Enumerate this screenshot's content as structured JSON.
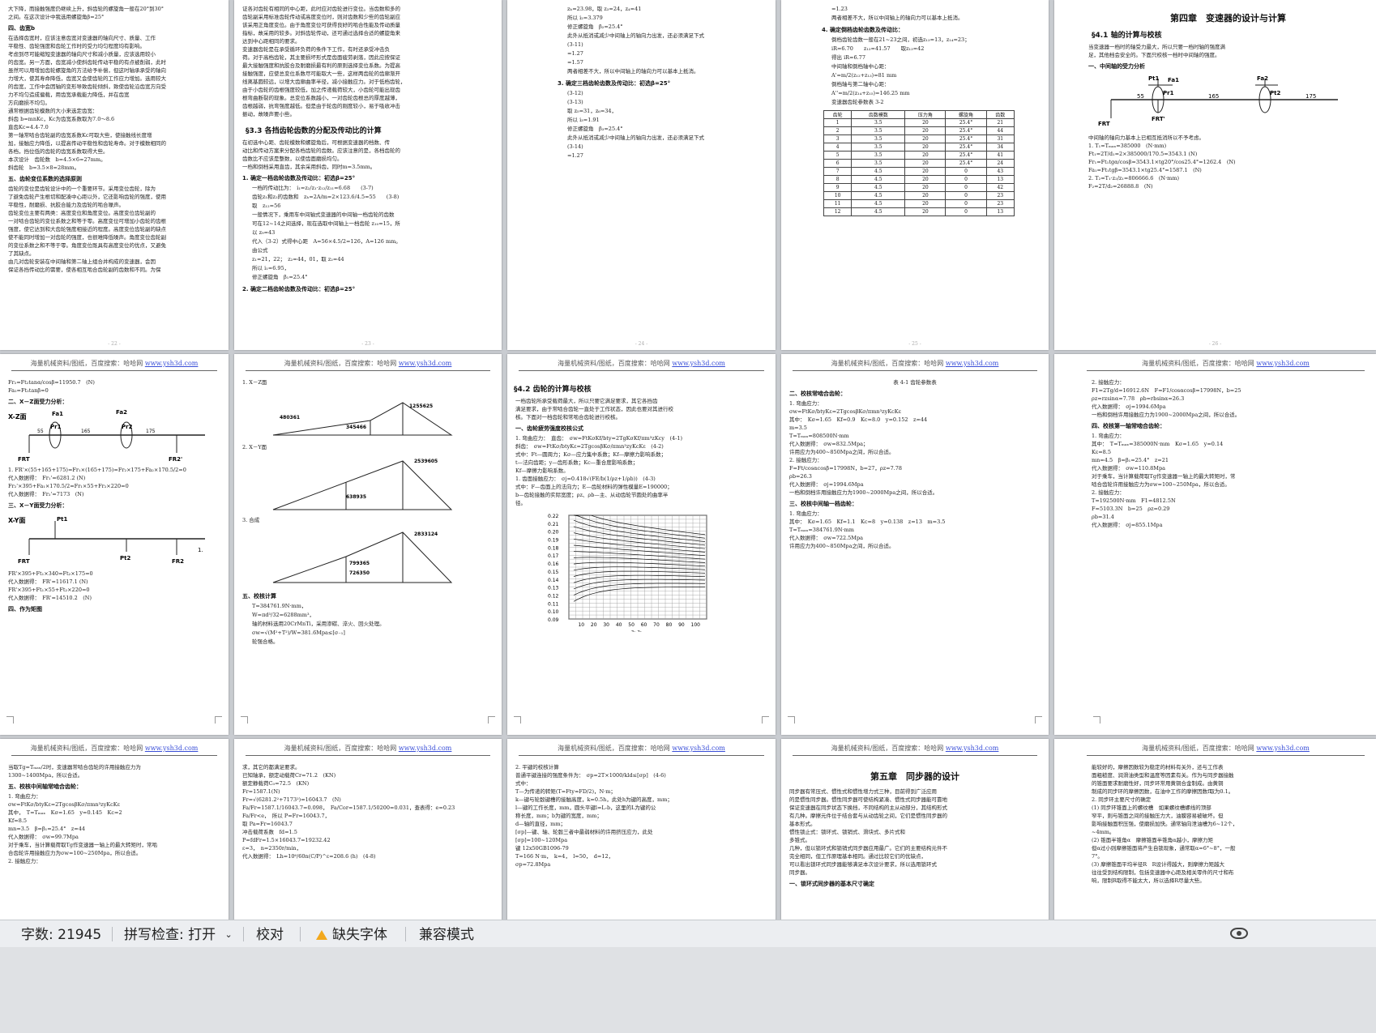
{
  "status_bar": {
    "word_count": "字数: 21945",
    "spell_check": "拼写检查: 打开",
    "proofread": "校对",
    "missing_fonts": "缺失字体",
    "compat_mode": "兼容模式"
  },
  "watermark": "海量机械资料/图纸，百度搜索：哈哈网",
  "watermark_url": "www.ysh3d.com",
  "pages": {
    "p1": {
      "lines": [
        "大下降，而接触强度仍继续上升，斜齿轮的螺旋角一般在20°到30°",
        "之间。在这次设计中我选用螺旋角β=25°",
        "四、齿宽b",
        "在选择齿宽时，应该注意齿宽对变速器的轴向尺寸、质量、工作",
        "平稳性、齿轮强度和齿轮工作时的受力均匀程度均有影响。",
        "考虑到尽可能缩短变速器的轴向尺寸和减小质量，应该选用较小",
        "的齿宽。另一方面，齿宽减小使斜齿轮传动平稳的有点被削弱，此时",
        "虽然可以用增加齿轮螺旋角的方法给予补偿，但这时轴承承受的轴向",
        "力增大，使其寿命降低，齿宽又会使齿轮的工作应力增加。选用较大",
        "的齿宽，工作中会因轴的变形导致齿轮倾斜，致使齿轮沿齿宽方向受",
        "力不均匀造成偏载，用齿宽承载能力降低，并在齿宽",
        "方向磨损不均匀。",
        "通常根据齿轮模数的大小来选定齿宽：",
        "斜齿 b=mnKc，Kc为齿宽系数取为7.0～8.6",
        "直齿Kc=4.4-7.0",
        "第一轴常啮合齿轮副的齿宽系数Kc可取大些，使接触线长度增",
        "加，接触应力降低，以提高传动平稳性和齿轮寿命。对于模数相同的",
        "各档，挡位低的齿轮的齿宽系数取得大些。",
        "本次设计　齿轮数　b=4.5×6=27mm。",
        "斜齿轮　b=3.5×8=28mm。",
        "五、齿轮变位系数的选择原则",
        "齿轮的变位是齿轮设计中的一个重要环节。采用变位齿轮，除为",
        "了避免齿轮产生根切和配凑中心距以外，它还影响齿轮的强度，使用",
        "平稳性，耐磨损、抗胶合能力及齿轮的啮合噪声。",
        "齿轮变位主要有两类：高度变位和角度变位。高度变位齿轮副的",
        "一对啮合齿轮的变位系数之和等于零。高度变位可增加小齿轮的齿根",
        "强度，使它达到和大齿轮强度相接近的程度。高度变位齿轮副的缺点",
        "使不能同时增加一对齿轮的强度，也很难降低噪声。角度变位齿轮副",
        "的变位系数之和不等于零。角度变位既具有高度变位的优点，又避免",
        "了其缺点。",
        "由几对齿轮安装在中间轴和第二轴上组合并构成的变速器，会因",
        "保证各挡传动比的需要，使各相互啮合齿轮副的齿数和不同。为保"
      ]
    },
    "p2": {
      "top_lines": [
        "证各对齿轮有相同的中心距，此时应对齿轮进行变位。当齿数和多的",
        "齿轮副采用标准齿轮传动或高度变位时，则对齿数和少些的齿轮副应",
        "该采用正角度变位。由于角度变位可获得良好的啮合性能及传动质量",
        "指标，故采用的较多。对斜齿轮传动，还可通过选择合适的螺旋角来",
        "达到中心距相同的要求。",
        "变速器齿轮是在承受循环负荷的条件下工作，有时还承受冲击负",
        "荷。对于高档齿轮，其主要损坏形式是齿面疲劳剥落，因此应按保证",
        "最大接触强度和抗胶合及耐磨损最有利的原则选择变位系数。为提高",
        "接触强度，应使总变位系数尽可能取大一些，这样两齿轮的齿廓渐开",
        "线离基圆较远，以增大齿廓曲率半径，减小接触应力。对于低档齿轮，",
        "由于小齿轮的齿根强度较低，加之传递载荷较大，小齿轮可能出现齿",
        "根弯曲断裂的现象。总变位系数越小，一对齿轮齿根总的厚度越薄，",
        "齿根越弱，抗弯强度越低。但是由于轮齿的刚度较小，易于吸收冲击",
        "振动，故噪声要小些。"
      ],
      "section": "§3.3 各挡齿轮齿数的分配及传动比的计算",
      "body_lines": [
        "在初选中心距、齿轮模数和螺旋角后，可根据变速器的档数、传",
        "动比和传动方案来分配各档齿轮的齿数。应该注意的是，各档齿轮的",
        "齿数比不应该是整数，以使齿面磨损均匀。",
        "一档和倒档采用直齿，其余采用斜齿，同时m=3.5mm。"
      ],
      "h1": "1. 确定一档齿轮齿数及传动比：初选β=25°",
      "items": [
        "一档的传动比为：　i₁=z₂/z₁·z₁₂/z₁₁=6.68　　(3-7)",
        "齿轮z₁和z₂的齿数和　zₕ=2A/m=2×123.6/4.5=55　　(3-8)",
        "取　z₁₂=56",
        "一般情况下，乘用车中间轴式变速器的中间轴一档齿轮的齿数",
        "可在12~14之间选择，现在选取中间轴上一档齿轮 z₁₀=15，所",
        "以 z₉=43",
        "代入（3-2）式得中心距　A=56×4.5/2=126，A=126 mm。",
        "由公式",
        "z₁=21，22；　z₂=44，01，取 z₂=44",
        "所以 i₁=6.95，",
        "修正螺旋角　β₁=25.4°"
      ],
      "h2": "2. 确定二档齿轮齿数及传动比：初选β=25°"
    },
    "p3": {
      "lines": [
        "zₕ=23.98，取 z₃=24，z₄=41",
        "所以 i₂=3.379",
        "修正螺旋角　β₂=25.4°",
        "此外从抵消或减少中间轴上的轴向力出发，还必须满足下式",
        "(3-11)",
        "=1.27",
        "=1.57",
        "两者相差不大，所以中间轴上的轴向力可以基本上抵消。",
        "3. 确定三档齿轮齿数及传动比：初选β=25°",
        "(3-12)",
        "(3-13)",
        "取 z₅=31，z₆=34，",
        "所以 i₃=1.91",
        "修正螺旋角　β₃=25.4°",
        "此外从抵消或减少中间轴上的轴向力出发，还必须满足下式",
        "(3-14)",
        "=1.27"
      ]
    },
    "p4": {
      "lines": [
        "=1.23",
        "两者相差不大，所以中间轴上的轴向力可以基本上抵消。",
        "4. 确定倒档齿轮齿数及传动比：",
        "倒档齿轮齿数一般在21~23之间，初选z₁₃=13，z₁₄=23；",
        "iR=6.70　　z₁₃=41.57　　取z₁₃=42",
        "得出 iR=6.77",
        "中间轴和倒档轴中心距：",
        "A'=m/2(z₁₂+z₁₃)=81 mm",
        "倒档轴与第二轴中心距：",
        "A''=m/2(z₁₄+z₁₅)=146.25 mm",
        "变速器齿轮参数表 3-2"
      ],
      "table_headers": [
        "齿轮",
        "齿数模数",
        "压力角",
        "螺旋角",
        "齿数"
      ],
      "table_rows": [
        [
          "1",
          "3.5",
          "20",
          "25.4°",
          "21"
        ],
        [
          "2",
          "3.5",
          "20",
          "25.4°",
          "44"
        ],
        [
          "3",
          "3.5",
          "20",
          "25.4°",
          "31"
        ],
        [
          "4",
          "3.5",
          "20",
          "25.4°",
          "34"
        ],
        [
          "5",
          "3.5",
          "20",
          "25.4°",
          "41"
        ],
        [
          "6",
          "3.5",
          "20",
          "25.4°",
          "24"
        ],
        [
          "7",
          "4.5",
          "20",
          "0",
          "43"
        ],
        [
          "8",
          "4.5",
          "20",
          "0",
          "13"
        ],
        [
          "9",
          "4.5",
          "20",
          "0",
          "42"
        ],
        [
          "10",
          "4.5",
          "20",
          "0",
          "23"
        ],
        [
          "11",
          "4.5",
          "20",
          "0",
          "23"
        ],
        [
          "12",
          "4.5",
          "20",
          "0",
          "13"
        ]
      ]
    },
    "p5": {
      "chapter": "第四章　变速器的设计与计算",
      "section": "§4.1 轴的计算与校核",
      "lines": [
        "当变速器一档时的轴受力最大，所以只要一档时轴的强度满",
        "足，其他档会安全的。下面只校核一档时中间轴的强度。",
        "一、中间轴的受力分析",
        "中间轴的轴向力基本上已相互抵消所以不予考虑。",
        "1. T₁=Tₘₐₓ=385000　(N·mm)",
        "Ft₁=2T/d₁=2×385000/170.5=3543.1 (N)",
        "Fr₁=Ft₁tgα/cosβ=3543.1×tg20°/cos25.4°=1262.4　(N)",
        "Fa₁=Ft₁tgβ=3543.1×tg25.4°=1587.1　(N)",
        "2. T₂=T₁·z₂/z₁=806666.6　(N·mm)",
        "F₂=2T/d₂=26888.8　(N)"
      ],
      "diagram_labels": [
        "Pt1",
        "Fa1",
        "Pr1",
        "55",
        "165",
        "Fa2",
        "Pt2",
        "175",
        "FRT",
        "FRT'"
      ]
    },
    "p6": {
      "lines": [
        "Fr₂=Ft₂tanα/cosβ=11950.7　(N)",
        "Fa₂=Ft₂tanβ=0",
        "二、X－Z面受力分析：",
        "1. FR'×(55+165+175)=Fr₁×(165+175)=Fr₂×175+Fa₂×170.5/2=0",
        "代入数据得：　Fr₁'=6281.2 (N)",
        "Fr₂'×395+Fa₁×170.5/2=Fr₁×55+Fr₂×220=0",
        "代入数据得：　Fr₂'=7173　(N)",
        "三、X－Y面受力分析：",
        "FR'×395+Ft₁×340=Ft₂×175=0",
        "代入数据得：　FR'=11617.1 (N)",
        "FR'×395+Ft₁×55+Ft₂×220=0",
        "代入数据得：　FR'=14510.2　(N)",
        "四、作为矩图"
      ],
      "diagram_labels": [
        "X-Z面",
        "Fa1",
        "Fa2",
        "Pr1",
        "Pr2",
        "55",
        "165",
        "175",
        "FRT",
        "FR2'",
        "X-Y面",
        "Pt1",
        "Pt2",
        "FRT",
        "FR2"
      ],
      "page_num": "1."
    },
    "p7": {
      "lines": [
        "1. X－Z面",
        "2. X－Y面",
        "3. 合成",
        "五、校核计算",
        "T=384761.9N·mm，",
        "W=πd³/32=6288mm³，",
        "轴的材料选用20CrMnTi，采用渗碳、淬火、回火处理。",
        "σw=√(M²+T²)/W=381.6Mpa≤[σ₋₁]",
        "轮强合格。"
      ],
      "moment_values": [
        "480361",
        "345466",
        "1255625",
        "2539605",
        "638935",
        "2833124",
        "799365",
        "726350"
      ]
    },
    "p8": {
      "section": "§4.2 齿轮的计算与校核",
      "lines": [
        "一档齿轮所承受载荷最大，所以只要它满足要求，其它各挡齿",
        "满足要求，由于常啮合齿轮一直处于工作状态，因此也要对其进行校",
        "核。下面对一档齿轮和常啮合齿轮进行校核。",
        "一、齿轮疲劳强度校核公式",
        "1. 弯曲应力：　直齿：　σw=FtKσKf/bty=2TgKσKf/πm³zKcy　(4-1)",
        "斜齿：　σw=FtKσ/btyKε=2TgcosβKσ/πmn³zyKcKε　(4-2)",
        "式中：Ft—圆周力；Kσ—应力集中系数；Kf—摩擦力影响系数；",
        "t—法向齿距；y—齿形系数；Kc—重合度影响系数；",
        "Kf—摩擦力影响系数。",
        "1. 齿面接触应力：　σj=0.418√(FE/b(1/ρz+1/ρb))　(4-3)",
        "式中：F—齿面上的法向力；E—齿轮材料的弹性模量E=190000；",
        "b—齿轮接触的实际宽度；ρz、ρb—主、从动齿轮节圆处的曲率半",
        "径。"
      ],
      "chart_x_ticks": [
        "10",
        "20",
        "30",
        "40",
        "50",
        "60",
        "70",
        "80",
        "90",
        "100"
      ],
      "chart_y_ticks": [
        "0.22",
        "0.21",
        "0.20",
        "0.19",
        "0.18",
        "0.17",
        "0.16",
        "0.15",
        "0.14",
        "0.13",
        "0.12",
        "0.11",
        "0.10",
        "0.09"
      ],
      "chart_xlabel": "z₁ z₂"
    },
    "p9": {
      "header": "表 4-1 齿轮参数表",
      "lines": [
        "二、校核常啮合齿轮：",
        "1. 弯曲应力：",
        "σw=FtKσ/btyKε=2TgcosβKσ/πmn³zyKcKε",
        "其中：　Kσ=1.65　Kf=0.9　Kc=8.0　y=0.152　z=44",
        "m=3.5",
        "T=Tₘₐₓ=808500N·mm",
        "代入数据得：　σw=832.5Mpa；",
        "许用应力为400~850Mpa之间，所以合适。",
        "2. 接触应力：",
        "F=Ft/cosαcosβ=17998N，b=27，ρz=7.78",
        "ρb=26.3",
        "代入数据得：　σj=1994.6Mpa",
        "一档和倒档许用接触应力为1900~2000Mpa之间，所以合适。",
        "三、校核中间轴一档齿轮：",
        "1. 弯曲应力：",
        "其中：　Kσ=1.65　Kf=1.1　Kc=8　y=0.138　z=13　m=3.5",
        "T=Tₘₐₓ=384761.9N·mm",
        "代入数据得：　σw=722.5Mpa",
        "许用应力为400~850Mpa之间，所以合适。"
      ]
    },
    "p10": {
      "lines": [
        "2. 接触应力：",
        "F1=2Tg/d=16912.6N　F=F1/cosαcosβ=17998N，b=25",
        "ρz=rzsinα=7.78　ρb=rbsinα=26.3",
        "代入数据得：　σj=1994.6Mpa",
        "一档和倒档许用接触应力为1900~2000Mpa之间，所以合适。",
        "四、校核第一轴常啮合齿轮：",
        "1. 弯曲应力：",
        "其中：　T=Tₘₐₓ=385000N·mm　Kσ=1.65　y=0.14",
        "Kε=8.5",
        "mn=4.5　β=β₁=25.4°　z=21",
        "代入数据得：　σw=110.8Mpa",
        "对于乘车，当计算载荷取Tg作变速器一轴上的最大转矩时，常",
        "啮合齿轮许用接触应力为σw=100~250Mpa，所以合适。",
        "2. 接触应力：",
        "T=192500N·mm　F1=4812.5N",
        "F=5103.3N　b=25　ρz=0.29",
        "ρb=31.4",
        "代入数据得：　σj=855.1Mpa"
      ]
    },
    "p11": {
      "lines": [
        "当取Tg=Tₘₐₓ/2时，变速器常啮合齿轮的许用接触应力为",
        "1300~1400Mpa，所以合适。",
        "五、校核中间轴常啮合齿轮：",
        "1. 弯曲应力：",
        "σw=FtKσ/btyKε=2TgcosβKσ/πmn³zyKcKε",
        "其中，　T=Tₘₐₓ　Kσ=1.65　y=0.145　Kc=2",
        "Kf=8.5",
        "mn=3.5　β=β₁=25.4°　z=44",
        "代入数据得：　σw=99.7Mpa",
        "对于乘车，当计算载荷取Tg作变速器一轴上的最大转矩时，常啮",
        "合齿轮许用接触应力为σw=100~250Mpa，所以合适。",
        "2. 接触应力："
      ]
    },
    "p12": {
      "lines": [
        "求，其它的都满足要求。",
        "已知轴承，额定动载荷Cr=71.2　(KN)",
        "额定静载荷C₀=72.5　(KN)",
        "Fr=1587.1(N)",
        "Fr=√(6281.2²+7173²)=16043.7　(N)",
        "Fa/Fr=1587.1/16043.7=0.098，　Fa/Cor=1587.1/50200=0.031，查表得：e=0.23",
        "Fa/Fr<e，　所以 P=Fr=16043.7，",
        "取 Pa=Fr=16043.7",
        "冲击载荷系数　fd=1.5",
        "P=fdFr=1.5×16043.7=19232.42",
        "ε=3，　n=2350r/min，",
        "代入数据得：　Lh=10⁶/60n(C/P)^ε=208.6 (h)　(4-8)"
      ]
    },
    "p13": {
      "lines": [
        "2. 平键的校核计算",
        "普通平键连接的强度条件为：　σp=2T×1000/kld≤[σp]　(4-6)",
        "式中：",
        "T—为传递的转矩(T=Fty≈FD/2)，N·m；",
        "k—键与轮毂键槽的接触高度，k=0.5h，此处h为键的高度，mm；",
        "l—键的工作长度，mm，圆头平键l=L-b，这里的L为键的公",
        "称长度，mm；b为键的宽度，mm；",
        "d—轴的直径，mm；",
        "[σp]—键、轴、轮毂三者中最弱材料的许用挤压应力，此处",
        "[σp]=100~120Mpa",
        "键 12x50GB1096-79",
        "T=166 N·m，　k=4，　l=50，　d=12，",
        "σp=72.8Mpa"
      ]
    },
    "p14": {
      "chapter": "第五章　同步器的设计",
      "lines": [
        "同步器有常压式、惯性式和惯性增力式三种，目前得到广泛应用",
        "的是惯性同步器。惯性同步器可使结构紧凑、惯性式同步器能可靠地",
        "保证变速器在同步状态下换挡，不同结构的主从动部分，其结构形式",
        "有几种。摩擦元件位于结合套与从动齿轮之间，它们是惯性同步器的",
        "基本形式。",
        "惯性锁止式：锁环式、锁销式、滑块式、多片式和",
        "多锥式。",
        "几种，但以锁环式和锁销式同步器应用最广。它们的主要结构元件不",
        "完全相同，但工作原理基本相同。通过比较它们的优缺点，",
        "可以看出锁环式同步器能够满足本次设计要求，所以选用锁环式",
        "同步器。",
        "一、锁环式同步器的基本尺寸确定"
      ]
    },
    "p15": {
      "lines": [
        "能较好的，摩擦因数较为稳定的材料有关外，还与工作表",
        "面粗糙度、润滑油类型和温度等因素有关。作为与同步器接触",
        "的锥面要求耐磨性好，同步环常用黄铜合金制成。由黄铜",
        "制成的同步环的摩擦因数，在油中工作的摩擦因数f取为0.1。",
        "2. 同步环主要尺寸的确定",
        "(1) 同步环锥面上的螺纹槽　如果螺纹槽螺线的顶部",
        "窄平，则与锥面之间的接触压力大，油膜容易被破坏。但",
        "影响接触面积压强，使磨损加快。通常轴向泄油槽为6~12个，",
        "~4mm。",
        "(2) 锥面半锥角α　摩擦锥面半锥角α越小，摩擦力矩",
        "但α过小则摩擦锥面将产生自锁现象，通常取α=6°~8°，一般",
        "7°。",
        "(3) 摩擦锥面平均半径R　R设计得越大，则摩擦力矩越大",
        "往往受到结构限制，包括变速器中心距及相关零件的尺寸和布",
        "响，限制R取得不能太大，所以选择R尽量大些。"
      ]
    }
  }
}
